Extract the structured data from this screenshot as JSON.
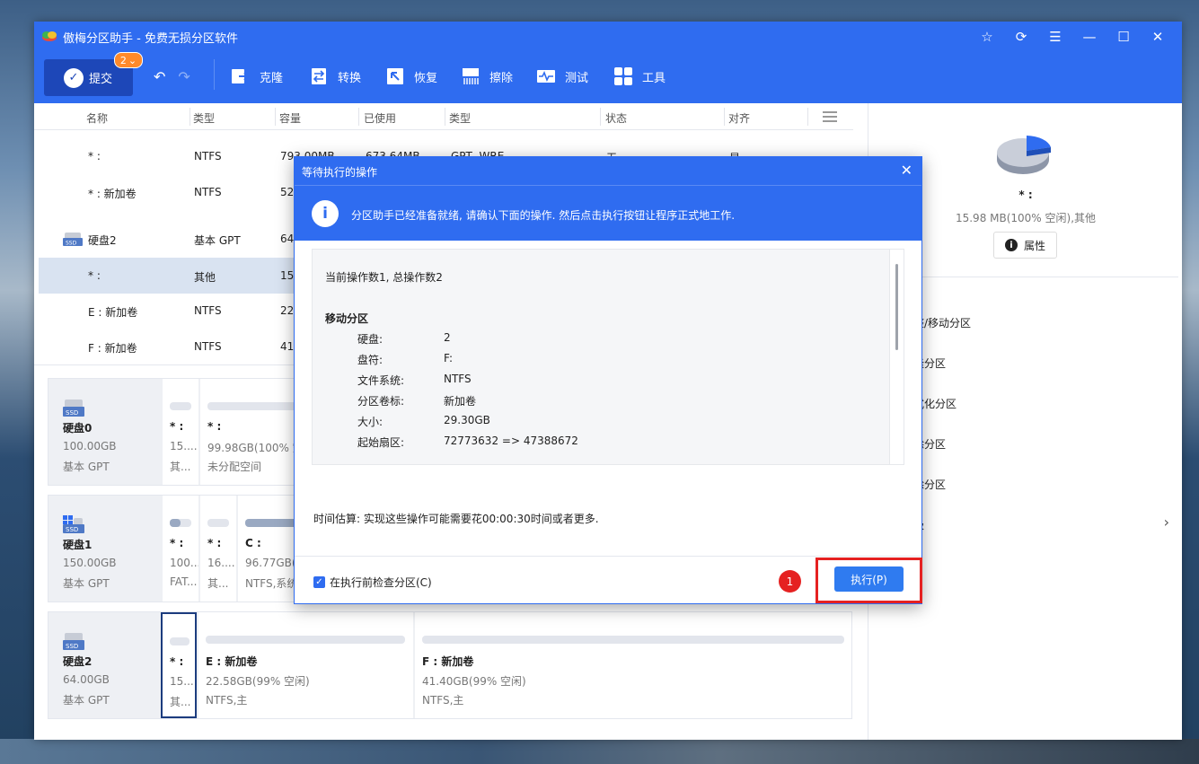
{
  "app": {
    "title": "傲梅分区助手 - 免费无损分区软件",
    "window_controls": [
      "star-icon",
      "refresh-icon",
      "menu-icon",
      "minimize-icon",
      "maximize-icon",
      "close-icon"
    ]
  },
  "toolbar": {
    "commit_label": "提交",
    "pending_count": "2",
    "items": [
      "克隆",
      "转换",
      "恢复",
      "擦除",
      "测试",
      "工具"
    ]
  },
  "columns": [
    "名称",
    "类型",
    "容量",
    "已使用",
    "类型",
    "状态",
    "对齐"
  ],
  "partitions": [
    {
      "name": "* :",
      "fs": "NTFS",
      "cap": "793.00MB",
      "used": "673.64MB",
      "ptype": "GPT, WRE",
      "status": "无",
      "align": "是"
    },
    {
      "name": "* : 新加卷",
      "fs": "NTFS",
      "cap": "52",
      "used": "",
      "ptype": "",
      "status": "",
      "align": ""
    },
    {
      "name": "硬盘2",
      "fs": "基本 GPT",
      "cap": "64",
      "used": "",
      "ptype": "",
      "status": "",
      "align": ""
    },
    {
      "name": "* :",
      "fs": "其他",
      "cap": "15",
      "used": "",
      "ptype": "",
      "status": "",
      "align": ""
    },
    {
      "name": "E : 新加卷",
      "fs": "NTFS",
      "cap": "22",
      "used": "",
      "ptype": "",
      "status": "",
      "align": ""
    },
    {
      "name": "F : 新加卷",
      "fs": "NTFS",
      "cap": "41",
      "used": "",
      "ptype": "",
      "status": "",
      "align": ""
    }
  ],
  "disks": [
    {
      "name": "硬盘0",
      "size": "100.00GB",
      "type": "基本 GPT",
      "parts": [
        {
          "label": "* :",
          "size": "15....",
          "fs": "其...",
          "usage": 0
        },
        {
          "label": "* :",
          "size": "99.98GB(100% 空",
          "fs": "未分配空间",
          "usage": 0
        }
      ]
    },
    {
      "name": "硬盘1",
      "size": "150.00GB",
      "type": "基本 GPT",
      "parts": [
        {
          "label": "* :",
          "size": "100....",
          "fs": "FAT...",
          "usage": 0.5
        },
        {
          "label": "* :",
          "size": "16....",
          "fs": "其...",
          "usage": 0
        },
        {
          "label": "C :",
          "size": "96.77GB(7",
          "fs": "NTFS,系统",
          "usage": 1
        }
      ]
    },
    {
      "name": "硬盘2",
      "size": "64.00GB",
      "type": "基本 GPT",
      "parts": [
        {
          "label": "* :",
          "size": "15....",
          "fs": "其...",
          "usage": 0
        },
        {
          "label": "E : 新加卷",
          "size": "22.58GB(99% 空闲)",
          "fs": "NTFS,主",
          "usage": 0
        },
        {
          "label": "F : 新加卷",
          "size": "41.40GB(99% 空闲)",
          "fs": "NTFS,主",
          "usage": 0
        }
      ]
    }
  ],
  "right_panel": {
    "part_name": "* :",
    "part_info": "15.98 MB(100% 空闲),其他",
    "prop_label": "属性",
    "operations": [
      "整/移动分区",
      "隆分区",
      "式化分区",
      "除分区",
      "除分区",
      "级"
    ]
  },
  "dialog": {
    "title": "等待执行的操作",
    "banner": "分区助手已经准备就绪, 请确认下面的操作. 然后点击执行按钮让程序正式地工作.",
    "op_count": "当前操作数1, 总操作数2",
    "op_heading": "移动分区",
    "fields": [
      {
        "label": "硬盘:",
        "value": "2"
      },
      {
        "label": "盘符:",
        "value": "F:"
      },
      {
        "label": "文件系统:",
        "value": "NTFS"
      },
      {
        "label": "分区卷标:",
        "value": "新加卷"
      },
      {
        "label": "大小:",
        "value": "29.30GB"
      },
      {
        "label": "起始扇区:",
        "value": "72773632 => 47388672"
      }
    ],
    "time_estimate": "时间估算: 实现这些操作可能需要花00:00:30时间或者更多.",
    "check_label": "在执行前检查分区(C)",
    "step_marker": "1",
    "execute_label": "执行(P)"
  },
  "colors": {
    "accent": "#2f6cf0",
    "highlight": "#e52121",
    "selected_row": "#d9e3f1"
  }
}
